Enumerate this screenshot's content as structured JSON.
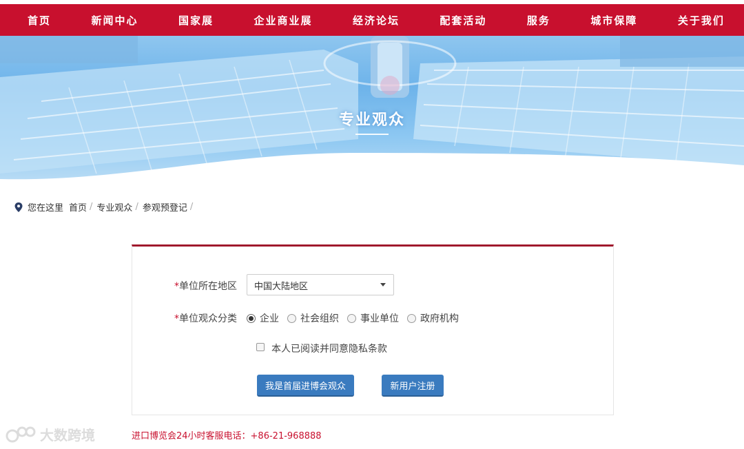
{
  "nav": {
    "items": [
      "首页",
      "新闻中心",
      "国家展",
      "企业商业展",
      "经济论坛",
      "配套活动",
      "服务",
      "城市保障",
      "关于我们"
    ],
    "color": "#c8102e"
  },
  "banner": {
    "title": "专业观众"
  },
  "breadcrumb": {
    "lead": "您在这里",
    "items": [
      "首页",
      "专业观众",
      "参观预登记"
    ],
    "separator": "/"
  },
  "form": {
    "region_label": "单位所在地区",
    "region_value": "中国大陆地区",
    "category_label": "单位观众分类",
    "required_mark": "*",
    "categories": [
      {
        "label": "企业",
        "selected": true
      },
      {
        "label": "社会组织",
        "selected": false
      },
      {
        "label": "事业单位",
        "selected": false
      },
      {
        "label": "政府机构",
        "selected": false
      }
    ],
    "agree_label": "本人已阅读并同意隐私条款",
    "agree_checked": false,
    "returning_button": "我是首届进博会观众",
    "register_button": "新用户注册",
    "button_color": "#3a7bbf",
    "panel_accent": "#a0182c"
  },
  "footer": {
    "hotline": "进口博览会24小时客服电话：+86-21-968888"
  },
  "watermark": {
    "text": "大数跨境"
  }
}
